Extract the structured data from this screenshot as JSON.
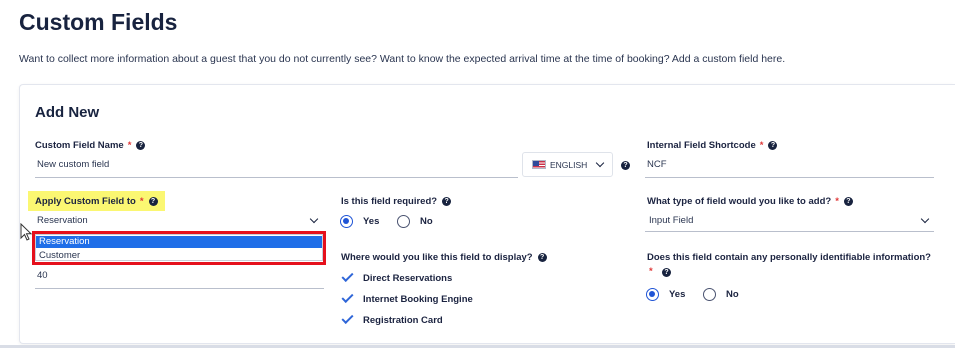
{
  "page": {
    "title": "Custom Fields",
    "intro": "Want to collect more information about a guest that you do not currently see? Want to know the expected arrival time at the time of booking? Add a custom field here."
  },
  "form": {
    "title": "Add New",
    "custom_field_name": {
      "label": "Custom Field Name",
      "required_mark": "*",
      "value": "New custom field"
    },
    "language": {
      "selected": "ENGLISH",
      "icon": "us-flag-icon"
    },
    "internal_shortcode": {
      "label": "Internal Field Shortcode",
      "required_mark": "*",
      "value": "NCF"
    },
    "apply_to": {
      "label": "Apply Custom Field to",
      "required_mark": "*",
      "selected": "Reservation",
      "options": [
        "Reservation",
        "Customer"
      ]
    },
    "partial_value": "40",
    "required_question": {
      "label": "Is this field required?",
      "options": [
        "Yes",
        "No"
      ],
      "selected": "Yes"
    },
    "display_question": {
      "label": "Where would you like this field to display?",
      "options": [
        "Direct Reservations",
        "Internet Booking Engine",
        "Registration Card"
      ],
      "checked": [
        "Direct Reservations",
        "Internet Booking Engine",
        "Registration Card"
      ]
    },
    "field_type": {
      "label": "What type of field would you like to add?",
      "required_mark": "*",
      "selected": "Input Field"
    },
    "pii_question": {
      "label": "Does this field contain any personally identifiable information?",
      "required_mark": "*",
      "options": [
        "Yes",
        "No"
      ],
      "selected": "Yes"
    }
  },
  "colors": {
    "accent": "#1f54d6",
    "highlight": "#fbf772",
    "annotation_red": "#e5101c",
    "selected_option": "#1f6ee8"
  }
}
